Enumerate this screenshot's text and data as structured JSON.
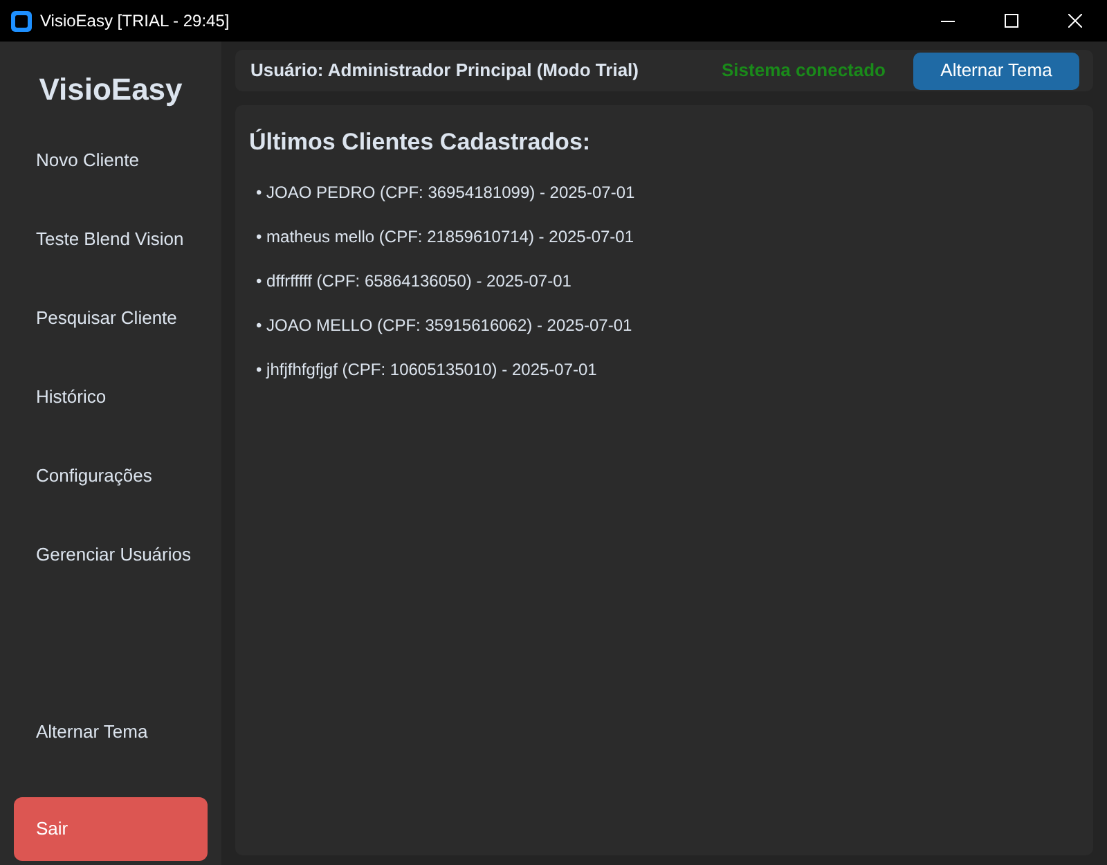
{
  "window": {
    "title": "VisioEasy [TRIAL - 29:45]"
  },
  "sidebar": {
    "logo": "VisioEasy",
    "items": [
      "Novo Cliente",
      "Teste Blend Vision",
      "Pesquisar Cliente",
      "Histórico",
      "Configurações",
      "Gerenciar Usuários"
    ],
    "theme_button": "Alternar Tema",
    "exit_button": "Sair"
  },
  "header": {
    "user": "Usuário: Administrador Principal (Modo Trial)",
    "status": {
      "text": "Sistema conectado",
      "connected": true
    },
    "theme_button": "Alternar Tema"
  },
  "content": {
    "title": "Últimos Clientes Cadastrados:",
    "clients": [
      "• JOAO PEDRO (CPF: 36954181099) - 2025-07-01",
      "• matheus mello (CPF: 21859610714) - 2025-07-01",
      "• dffrfffff (CPF: 65864136050) - 2025-07-01",
      "• JOAO MELLO (CPF: 35915616062) - 2025-07-01",
      "• jhfjfhfgfjgf (CPF: 10605135010) - 2025-07-01"
    ]
  }
}
